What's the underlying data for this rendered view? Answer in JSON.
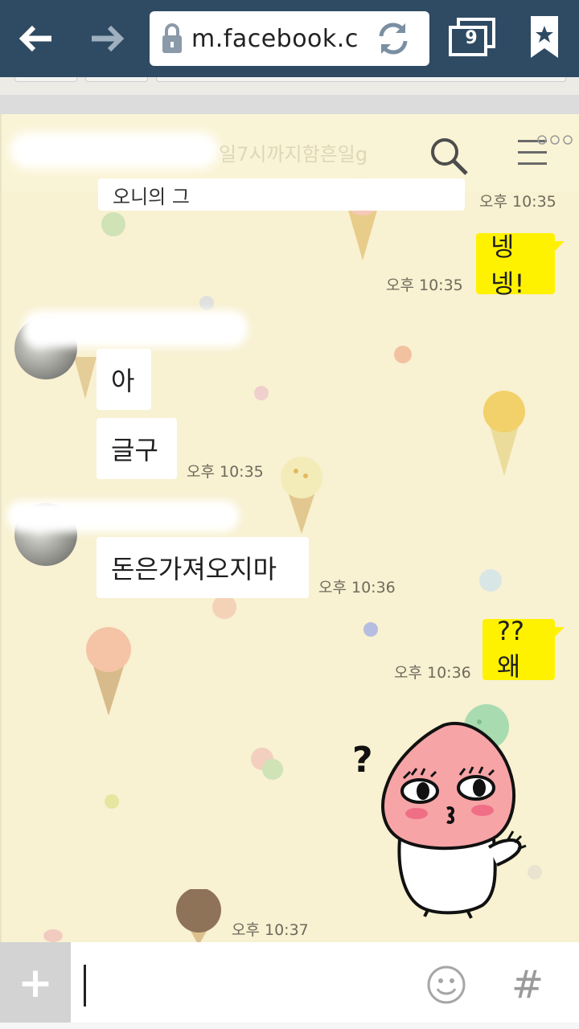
{
  "browser": {
    "url": "m.facebook.c",
    "tabs_count": "9",
    "back_icon": "back-arrow-icon",
    "forward_icon": "forward-arrow-icon",
    "lock_icon": "lock-icon",
    "refresh_icon": "refresh-icon",
    "bookmark_icon": "bookmark-star-icon"
  },
  "chat": {
    "header_faint_text": "일7시까지함흔일g",
    "partial_top_text": "오니의 그",
    "messages": [
      {
        "side": "right",
        "text": "넹넹!",
        "time": "오후 10:35"
      },
      {
        "side": "left",
        "text": "아",
        "time": ""
      },
      {
        "side": "left",
        "text": "글구",
        "time": "오후 10:35"
      },
      {
        "side": "left",
        "text": "돈은가져오지마",
        "time": "오후 10:36"
      },
      {
        "side": "right",
        "text": "??왜",
        "time": "오후 10:36"
      }
    ],
    "top_time": "오후 10:35",
    "sticker_mark": "?",
    "sticker_time": "오후 10:37",
    "sticker_name": "peach-character-sticker"
  },
  "input": {
    "plus_label": "+",
    "hash_label": "#",
    "emoji_icon": "smiley-icon"
  },
  "colors": {
    "bar": "#2f4b63",
    "chat_bg": "#f8f1d2",
    "my_bubble": "#fff200",
    "their_bubble": "#ffffff"
  }
}
